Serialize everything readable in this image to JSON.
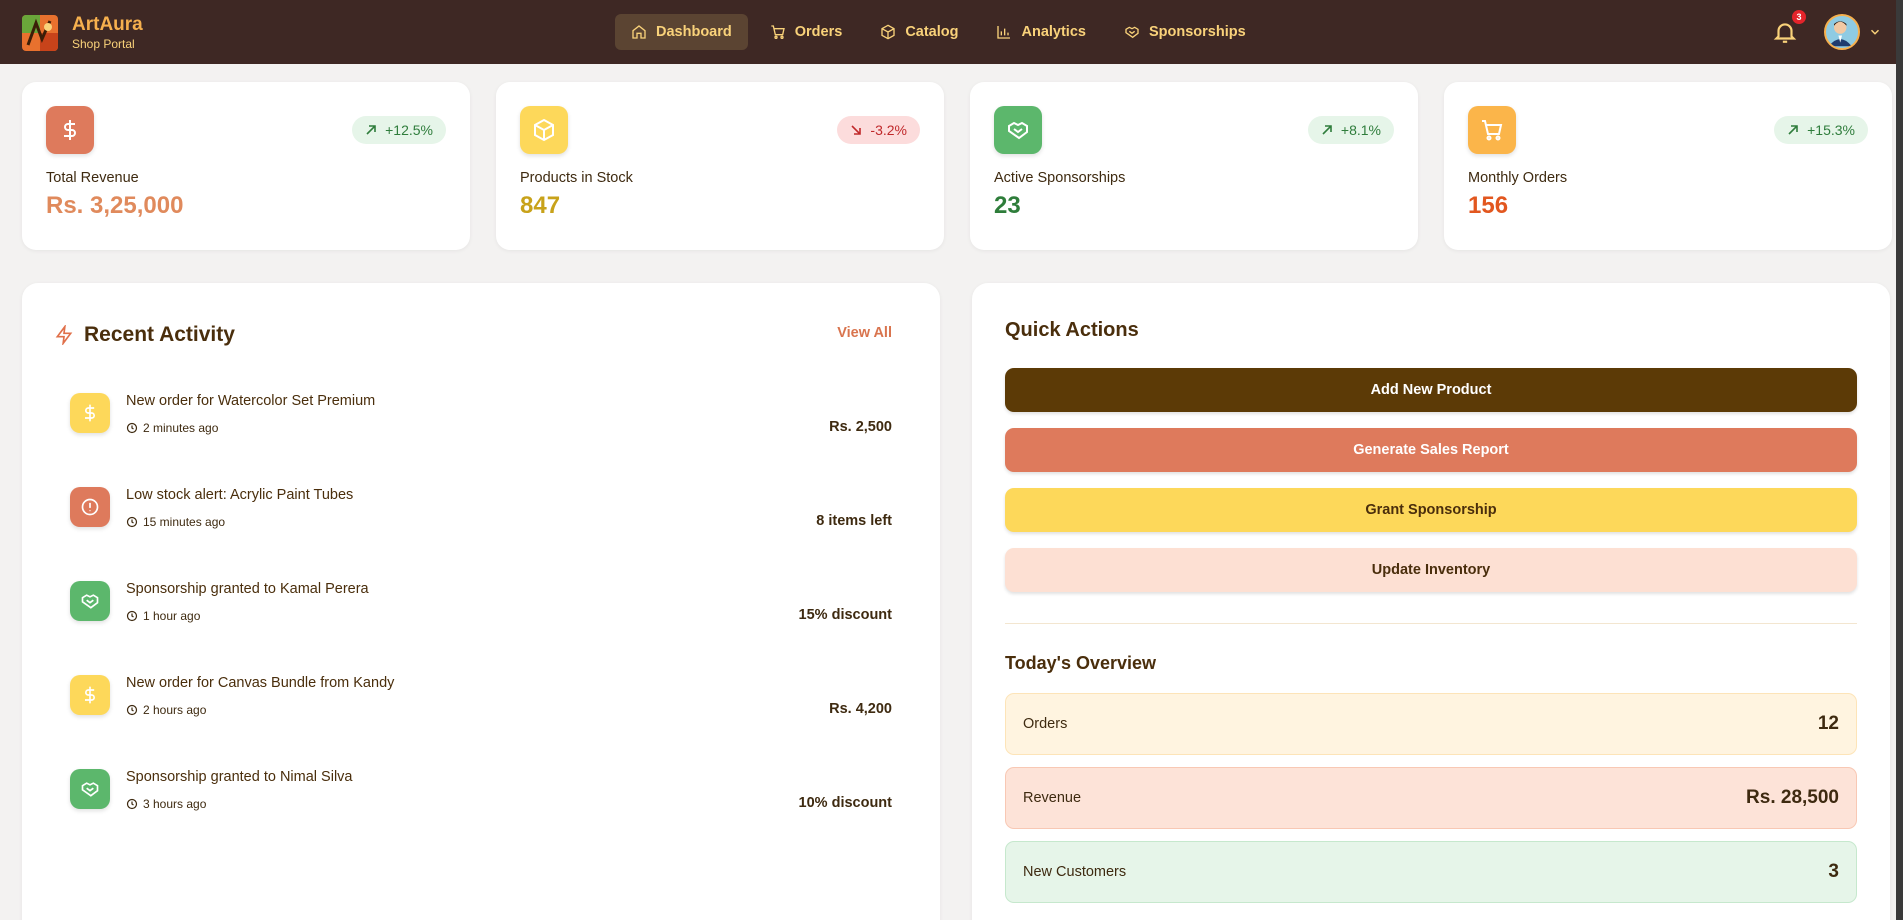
{
  "brand": {
    "name": "ArtAura",
    "subtitle": "Shop Portal"
  },
  "nav": [
    {
      "label": "Dashboard",
      "icon": "home-icon",
      "active": true
    },
    {
      "label": "Orders",
      "icon": "cart-icon"
    },
    {
      "label": "Catalog",
      "icon": "box-icon"
    },
    {
      "label": "Analytics",
      "icon": "bar-chart-icon"
    },
    {
      "label": "Sponsorships",
      "icon": "handshake-icon"
    }
  ],
  "notifications": {
    "count": "3"
  },
  "stats": [
    {
      "label": "Total Revenue",
      "value": "Rs. 3,25,000",
      "trend": "+12.5%",
      "direction": "up",
      "icon": "dollar-icon",
      "color": "#de7a5c",
      "valueColor": "#e08a5c"
    },
    {
      "label": "Products in Stock",
      "value": "847",
      "trend": "-3.2%",
      "direction": "down",
      "icon": "box-icon",
      "color": "#fdd85a",
      "valueColor": "#c8a21a"
    },
    {
      "label": "Active Sponsorships",
      "value": "23",
      "trend": "+8.1%",
      "direction": "up",
      "icon": "handshake-icon",
      "color": "#5cb76c",
      "valueColor": "#2e7d3a"
    },
    {
      "label": "Monthly Orders",
      "value": "156",
      "trend": "+15.3%",
      "direction": "up",
      "icon": "cart-icon",
      "color": "#fbb54a",
      "valueColor": "#e2571f"
    }
  ],
  "activity": {
    "title": "Recent Activity",
    "view_all": "View All",
    "items": [
      {
        "text": "New order for Watercolor Set Premium",
        "time": "2 minutes ago",
        "value": "Rs. 2,500",
        "icon": "dollar-icon",
        "color": "#fdd85a"
      },
      {
        "text": "Low stock alert: Acrylic Paint Tubes",
        "time": "15 minutes ago",
        "value": "8 items left",
        "icon": "alert-icon",
        "color": "#de7a5c"
      },
      {
        "text": "Sponsorship granted to Kamal Perera",
        "time": "1 hour ago",
        "value": "15% discount",
        "icon": "handshake-icon",
        "color": "#5cb76c"
      },
      {
        "text": "New order for Canvas Bundle from Kandy",
        "time": "2 hours ago",
        "value": "Rs. 4,200",
        "icon": "dollar-icon",
        "color": "#fdd85a"
      },
      {
        "text": "Sponsorship granted to Nimal Silva",
        "time": "3 hours ago",
        "value": "10% discount",
        "icon": "handshake-icon",
        "color": "#5cb76c"
      }
    ]
  },
  "quick_actions": {
    "title": "Quick Actions",
    "buttons": [
      {
        "label": "Add New Product",
        "bg": "#5c3a06",
        "fg": "#ffffff"
      },
      {
        "label": "Generate Sales Report",
        "bg": "#de7a5c",
        "fg": "#ffffff"
      },
      {
        "label": "Grant Sponsorship",
        "bg": "#fdd85a",
        "fg": "#4a2e0c"
      },
      {
        "label": "Update Inventory",
        "bg": "#fde0d3",
        "fg": "#4a2e0c"
      }
    ]
  },
  "overview": {
    "title": "Today's Overview",
    "rows": [
      {
        "label": "Orders",
        "value": "12",
        "bg": "#fff4e0",
        "border": "#fde4b8"
      },
      {
        "label": "Revenue",
        "value": "Rs. 28,500",
        "bg": "#fde3d8",
        "border": "#f8c8b4"
      },
      {
        "label": "New Customers",
        "value": "3",
        "bg": "#e6f5e9",
        "border": "#c6e8cd"
      }
    ]
  }
}
